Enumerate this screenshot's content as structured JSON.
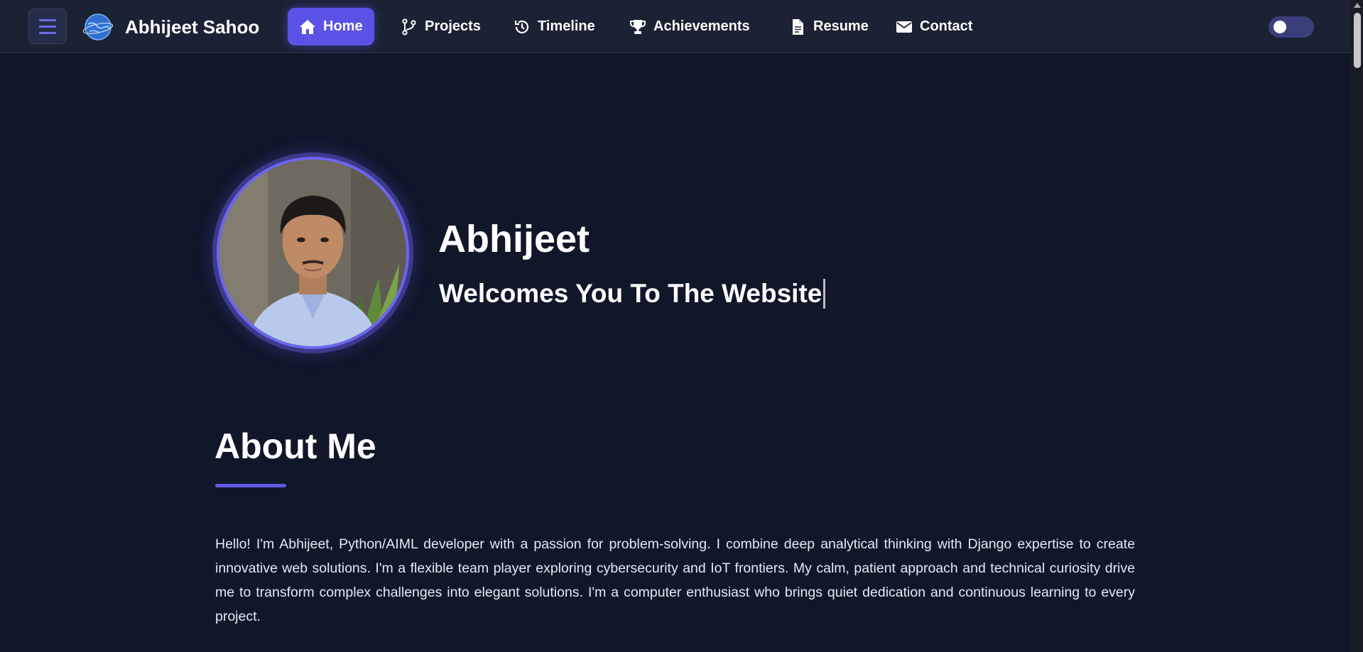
{
  "navbar": {
    "brand": "Abhijeet Sahoo",
    "items": [
      {
        "label": "Home",
        "icon": "home-icon",
        "active": true
      },
      {
        "label": "Projects",
        "icon": "branch-icon",
        "active": false
      },
      {
        "label": "Timeline",
        "icon": "history-icon",
        "active": false
      },
      {
        "label": "Achievements",
        "icon": "trophy-icon",
        "active": false
      },
      {
        "label": "Resume",
        "icon": "document-icon",
        "active": false
      },
      {
        "label": "Contact",
        "icon": "envelope-icon",
        "active": false
      }
    ],
    "theme_toggle": {
      "state": "off"
    }
  },
  "hero": {
    "name": "Abhijeet",
    "tagline": "Welcomes You To The Website"
  },
  "about": {
    "title": "About Me",
    "text": "Hello! I'm Abhijeet, Python/AIML developer with a passion for problem-solving. I combine deep analytical thinking with Django expertise to create innovative web solutions. I'm a flexible team player exploring cybersecurity and IoT frontiers. My calm, patient approach and technical curiosity drive me to transform complex challenges into elegant solutions. I'm a computer enthusiast who brings quiet dedication and continuous learning to every project."
  },
  "colors": {
    "background": "#0f1729",
    "navbar": "#1a2233",
    "accent": "#5b52e6",
    "text": "#ffffff"
  }
}
